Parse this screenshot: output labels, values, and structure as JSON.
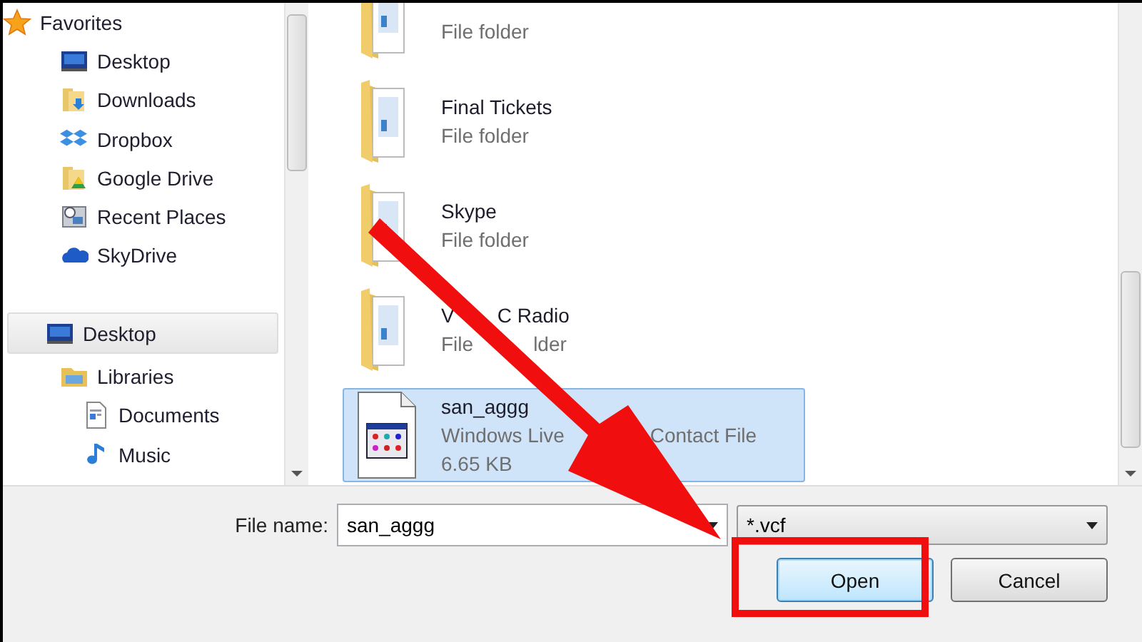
{
  "navigation": [
    {
      "label": "Favorites",
      "kind": "star",
      "selected": false,
      "children": [
        {
          "label": "Desktop",
          "kind": "monitor",
          "selected": false
        },
        {
          "label": "Downloads",
          "kind": "downloads",
          "selected": false
        },
        {
          "label": "Dropbox",
          "kind": "dropbox",
          "selected": false
        },
        {
          "label": "Google Drive",
          "kind": "drive",
          "selected": false
        },
        {
          "label": "Recent Places",
          "kind": "recent",
          "selected": false
        },
        {
          "label": "SkyDrive",
          "kind": "cloud",
          "selected": false
        }
      ]
    },
    {
      "label": "Desktop",
      "kind": "monitor",
      "selected": true,
      "children": [
        {
          "label": "Libraries",
          "kind": "library",
          "selected": false,
          "children": [
            {
              "label": "Documents",
              "kind": "document",
              "selected": false
            },
            {
              "label": "Music",
              "kind": "music",
              "selected": false
            }
          ]
        }
      ]
    }
  ],
  "files": [
    {
      "type": [
        "File folder"
      ],
      "kind": "folder",
      "selected": false
    },
    {
      "name": [
        "Final Tickets"
      ],
      "type": [
        "File folder"
      ],
      "kind": "folder",
      "selected": false
    },
    {
      "name": [
        "Skype"
      ],
      "type": [
        "File folder"
      ],
      "kind": "folder",
      "selected": false
    },
    {
      "name": [
        "V",
        "C Radio"
      ],
      "type": [
        "File",
        "lder"
      ],
      "kind": "folder",
      "selected": false
    },
    {
      "name": [
        "san_aggg"
      ],
      "type": [
        "Windows Live",
        "Contact File"
      ],
      "size": "6.65 KB",
      "kind": "contact",
      "selected": true
    }
  ],
  "file_name": {
    "label": "File name:",
    "value": "san_aggg"
  },
  "file_type": {
    "value": "*.vcf"
  },
  "buttons": [
    {
      "label": "Open",
      "focused": true
    },
    {
      "label": "Cancel",
      "focused": false
    }
  ]
}
